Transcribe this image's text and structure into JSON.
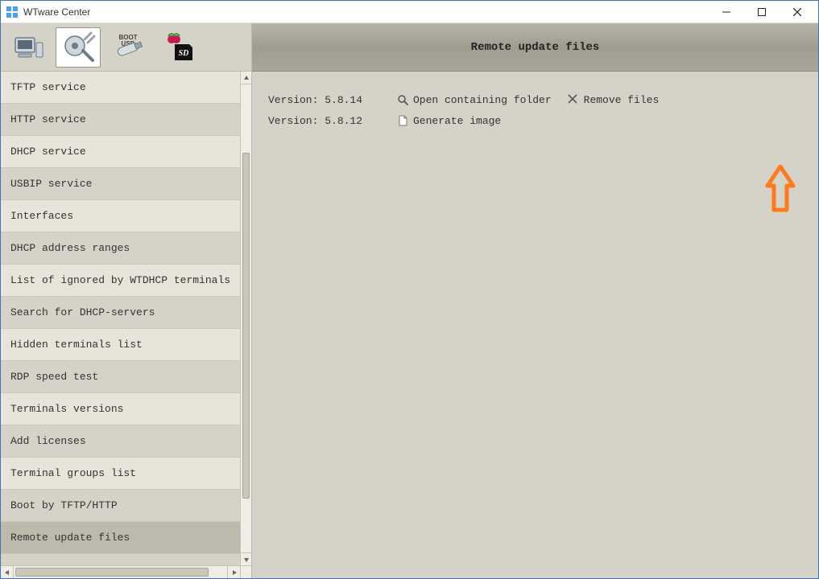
{
  "window": {
    "title": "WTware Center"
  },
  "toolbar": {
    "buttons": [
      {
        "name": "terminals-icon"
      },
      {
        "name": "tools-icon"
      },
      {
        "name": "boot-usb-icon"
      },
      {
        "name": "sd-card-icon"
      }
    ],
    "active_index": 1
  },
  "sidebar": {
    "items": [
      {
        "label": "TFTP service",
        "name": "sidebar-item-tftp-service"
      },
      {
        "label": "HTTP service",
        "name": "sidebar-item-http-service"
      },
      {
        "label": "DHCP service",
        "name": "sidebar-item-dhcp-service"
      },
      {
        "label": "USBIP service",
        "name": "sidebar-item-usbip-service"
      },
      {
        "label": "Interfaces",
        "name": "sidebar-item-interfaces"
      },
      {
        "label": "DHCP address ranges",
        "name": "sidebar-item-dhcp-address-ranges"
      },
      {
        "label": "List of ignored by WTDHCP terminals",
        "name": "sidebar-item-ignored-terminals"
      },
      {
        "label": "Search for DHCP-servers",
        "name": "sidebar-item-search-dhcp"
      },
      {
        "label": "Hidden terminals list",
        "name": "sidebar-item-hidden-terminals"
      },
      {
        "label": "RDP speed test",
        "name": "sidebar-item-rdp-speed-test"
      },
      {
        "label": "Terminals versions",
        "name": "sidebar-item-terminals-versions"
      },
      {
        "label": "Add licenses",
        "name": "sidebar-item-add-licenses"
      },
      {
        "label": "Terminal groups list",
        "name": "sidebar-item-terminal-groups"
      },
      {
        "label": "Boot by TFTP/HTTP",
        "name": "sidebar-item-boot-tftp-http"
      },
      {
        "label": "Remote update files",
        "name": "sidebar-item-remote-update-files"
      }
    ],
    "selected_index": 14
  },
  "main": {
    "title": "Remote update files",
    "rows": [
      {
        "version": "Version: 5.8.14",
        "actions": [
          {
            "icon": "magnifier-icon",
            "label": "Open containing folder",
            "name": "open-folder-link"
          },
          {
            "icon": "close-icon",
            "label": "Remove files",
            "name": "remove-files-link"
          }
        ]
      },
      {
        "version": "Version: 5.8.12",
        "actions": [
          {
            "icon": "document-icon",
            "label": "Generate image",
            "name": "generate-image-link"
          }
        ]
      }
    ]
  }
}
